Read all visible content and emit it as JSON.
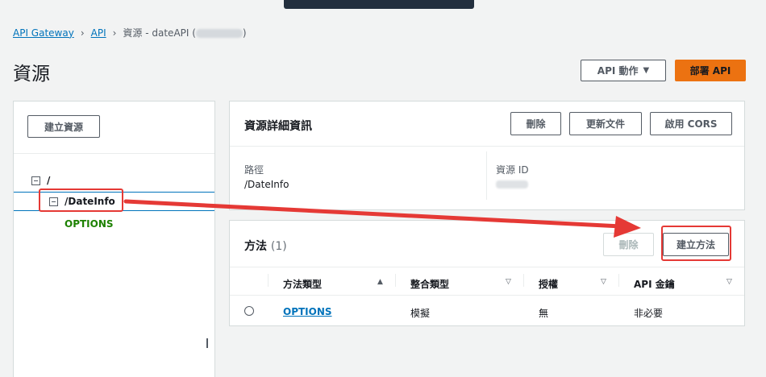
{
  "breadcrumb": {
    "items": [
      "API Gateway",
      "API"
    ],
    "current": "資源 - dateAPI (",
    "current_suffix": ")"
  },
  "page_title": "資源",
  "header_actions": {
    "api_actions_label": "API 動作",
    "deploy_label": "部署 API"
  },
  "resources_panel": {
    "create_resource_label": "建立資源",
    "tree": {
      "root": "/",
      "child": "/DateInfo",
      "method": "OPTIONS"
    }
  },
  "details_card": {
    "title": "資源詳細資訊",
    "delete_label": "刪除",
    "update_docs_label": "更新文件",
    "enable_cors_label": "啟用 CORS",
    "path_label": "路徑",
    "path_value": "/DateInfo",
    "resource_id_label": "資源 ID"
  },
  "methods_card": {
    "title": "方法",
    "count": "(1)",
    "delete_label": "刪除",
    "create_method_label": "建立方法",
    "columns": [
      "方法類型",
      "整合類型",
      "授權",
      "API 金鑰"
    ],
    "rows": [
      {
        "method": "OPTIONS",
        "integration": "模擬",
        "auth": "無",
        "api_key": "非必要"
      }
    ]
  },
  "colors": {
    "primary": "#ec7211",
    "link": "#0073bb",
    "method_green": "#1d8102",
    "annotation_red": "#e53935"
  }
}
